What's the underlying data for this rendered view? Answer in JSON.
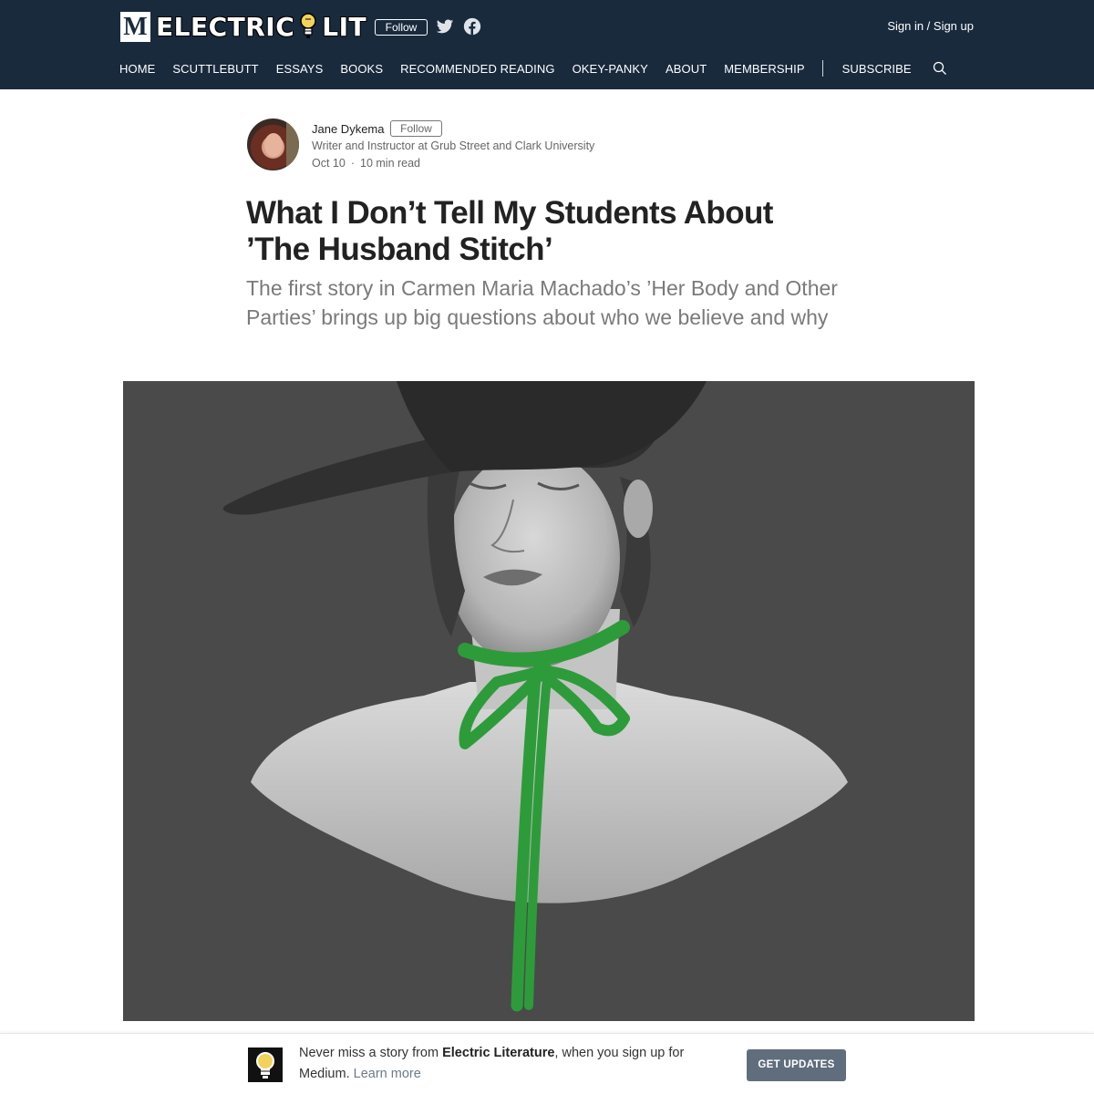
{
  "header": {
    "m_logo": "M",
    "brand_left": "ELECTRIC",
    "brand_right": "LIT",
    "follow_label": "Follow",
    "signin_label": "Sign in / Sign up",
    "bg_color": "#192a3d"
  },
  "nav": {
    "items": [
      "HOME",
      "SCUTTLEBUTT",
      "ESSAYS",
      "BOOKS",
      "RECOMMENDED READING",
      "OKEY-PANKY",
      "ABOUT",
      "MEMBERSHIP"
    ],
    "subscribe": "SUBSCRIBE"
  },
  "author": {
    "name": "Jane Dykema",
    "follow_label": "Follow",
    "bio": "Writer and Instructor at Grub Street and Clark University",
    "date": "Oct 10",
    "separator": "·",
    "read_time": "10 min read"
  },
  "article": {
    "title": "What I Don’t Tell My Students About ’The Husband Stitch’",
    "subtitle": "The first story in Carmen Maria Machado’s ’Her Body and Other Parties’ brings up big questions about who we believe and why"
  },
  "banner": {
    "text_before": "Never miss a story from ",
    "publication": "Electric Literature",
    "text_after": ", when you sign up for Medium. ",
    "learn_more": "Learn more",
    "button_label": "GET UPDATES"
  },
  "icons": [
    "twitter-icon",
    "facebook-icon",
    "search-icon",
    "lightbulb-icon"
  ],
  "colors": {
    "accent_ribbon": "#2e9b3a",
    "button_bg": "#5f6d7c"
  }
}
